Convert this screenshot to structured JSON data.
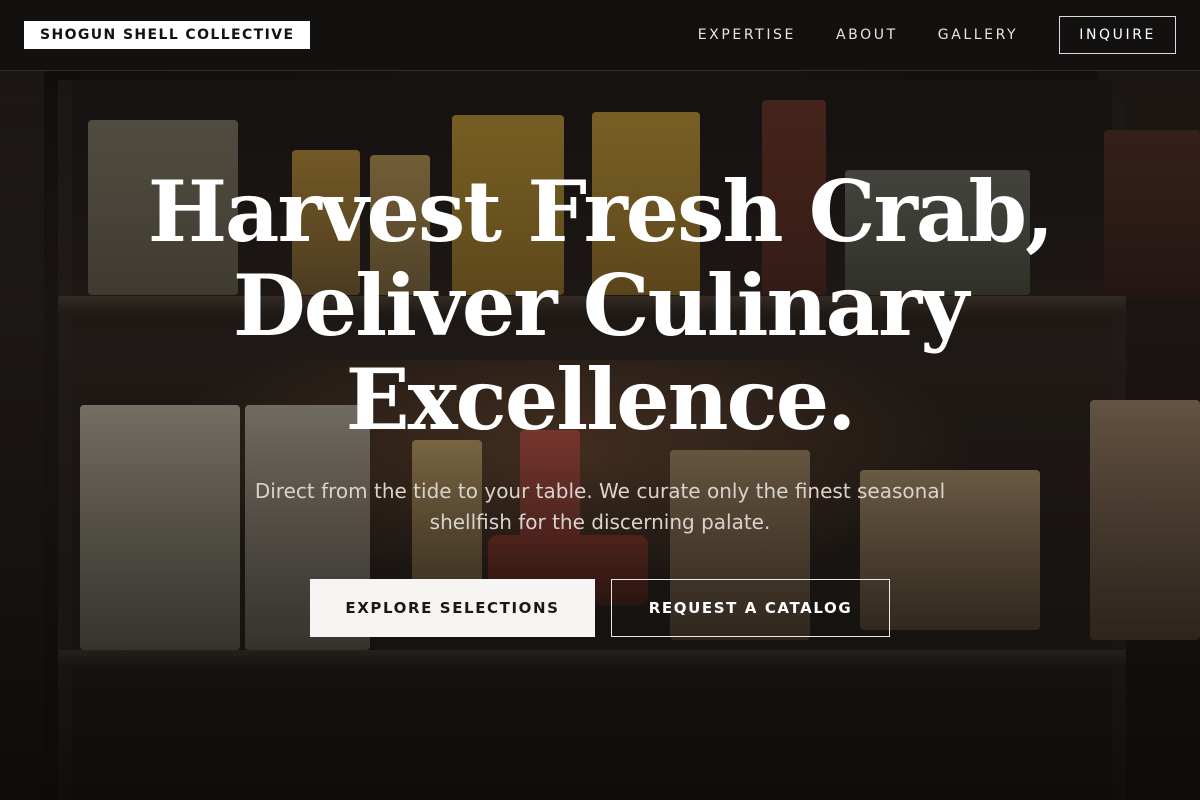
{
  "brand": {
    "name": "SHOGUN SHELL COLLECTIVE"
  },
  "nav": {
    "items": [
      {
        "label": "EXPERTISE"
      },
      {
        "label": "ABOUT"
      },
      {
        "label": "GALLERY"
      }
    ],
    "cta_label": "INQUIRE"
  },
  "hero": {
    "headline_lines": [
      "Harvest Fresh Crab,",
      "Deliver Culinary",
      "Excellence."
    ],
    "subtext": "Direct from the tide to your table. We curate only the finest seasonal shellfish for the discerning palate.",
    "primary_button": "EXPLORE SELECTIONS",
    "secondary_button": "REQUEST A CATALOG",
    "background_image": "pantry-shelf-photo"
  },
  "colors": {
    "background": "#1b1715",
    "text": "#ffffff",
    "button_fill": "#f7f5f3"
  }
}
